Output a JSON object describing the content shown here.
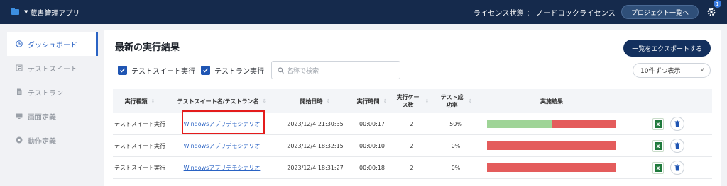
{
  "app": {
    "name": "蔵書管理アプリ"
  },
  "header": {
    "license_text": "ライセンス状態 ： ノードロックライセンス",
    "project_list_label": "プロジェクト一覧へ",
    "notification_count": "1"
  },
  "sidebar": {
    "items": [
      {
        "label": "ダッシュボード",
        "icon": "clock-icon",
        "active": true
      },
      {
        "label": "テストスイート",
        "icon": "suite-icon",
        "active": false
      },
      {
        "label": "テストラン",
        "icon": "document-icon",
        "active": false
      },
      {
        "label": "画面定義",
        "icon": "monitor-icon",
        "active": false
      },
      {
        "label": "動作定義",
        "icon": "gear-circle-icon",
        "active": false
      }
    ]
  },
  "main": {
    "title": "最新の実行結果",
    "export_label": "一覧をエクスポートする",
    "filter_suite": "テストスイート実行",
    "filter_run": "テストラン実行",
    "search_placeholder": "名称で検索",
    "page_size": "10件ずつ表示",
    "columns": [
      "実行種類",
      "テストスイート名/テストラン名",
      "開始日時",
      "実行時間",
      "実行ケース数",
      "テスト成功率",
      "実施結果"
    ],
    "rows": [
      {
        "type": "テストスイート実行",
        "name": "Windowsアプリデモシナリオ",
        "start": "2023/12/4 21:30:35",
        "duration": "00:00:17",
        "cases": "2",
        "rate": "50%",
        "success": 0.5
      },
      {
        "type": "テストスイート実行",
        "name": "Windowsアプリデモシナリオ",
        "start": "2023/12/4 18:32:15",
        "duration": "00:00:10",
        "cases": "2",
        "rate": "0%",
        "success": 0
      },
      {
        "type": "テストスイート実行",
        "name": "Windowsアプリデモシナリオ",
        "start": "2023/12/4 18:31:27",
        "duration": "00:00:18",
        "cases": "2",
        "rate": "0%",
        "success": 0
      }
    ]
  },
  "colors": {
    "topbar": "#152a4c",
    "accent": "#2a63c4",
    "success": "#9fd497",
    "failure": "#e45c5c",
    "highlight": "#e41c1c"
  }
}
